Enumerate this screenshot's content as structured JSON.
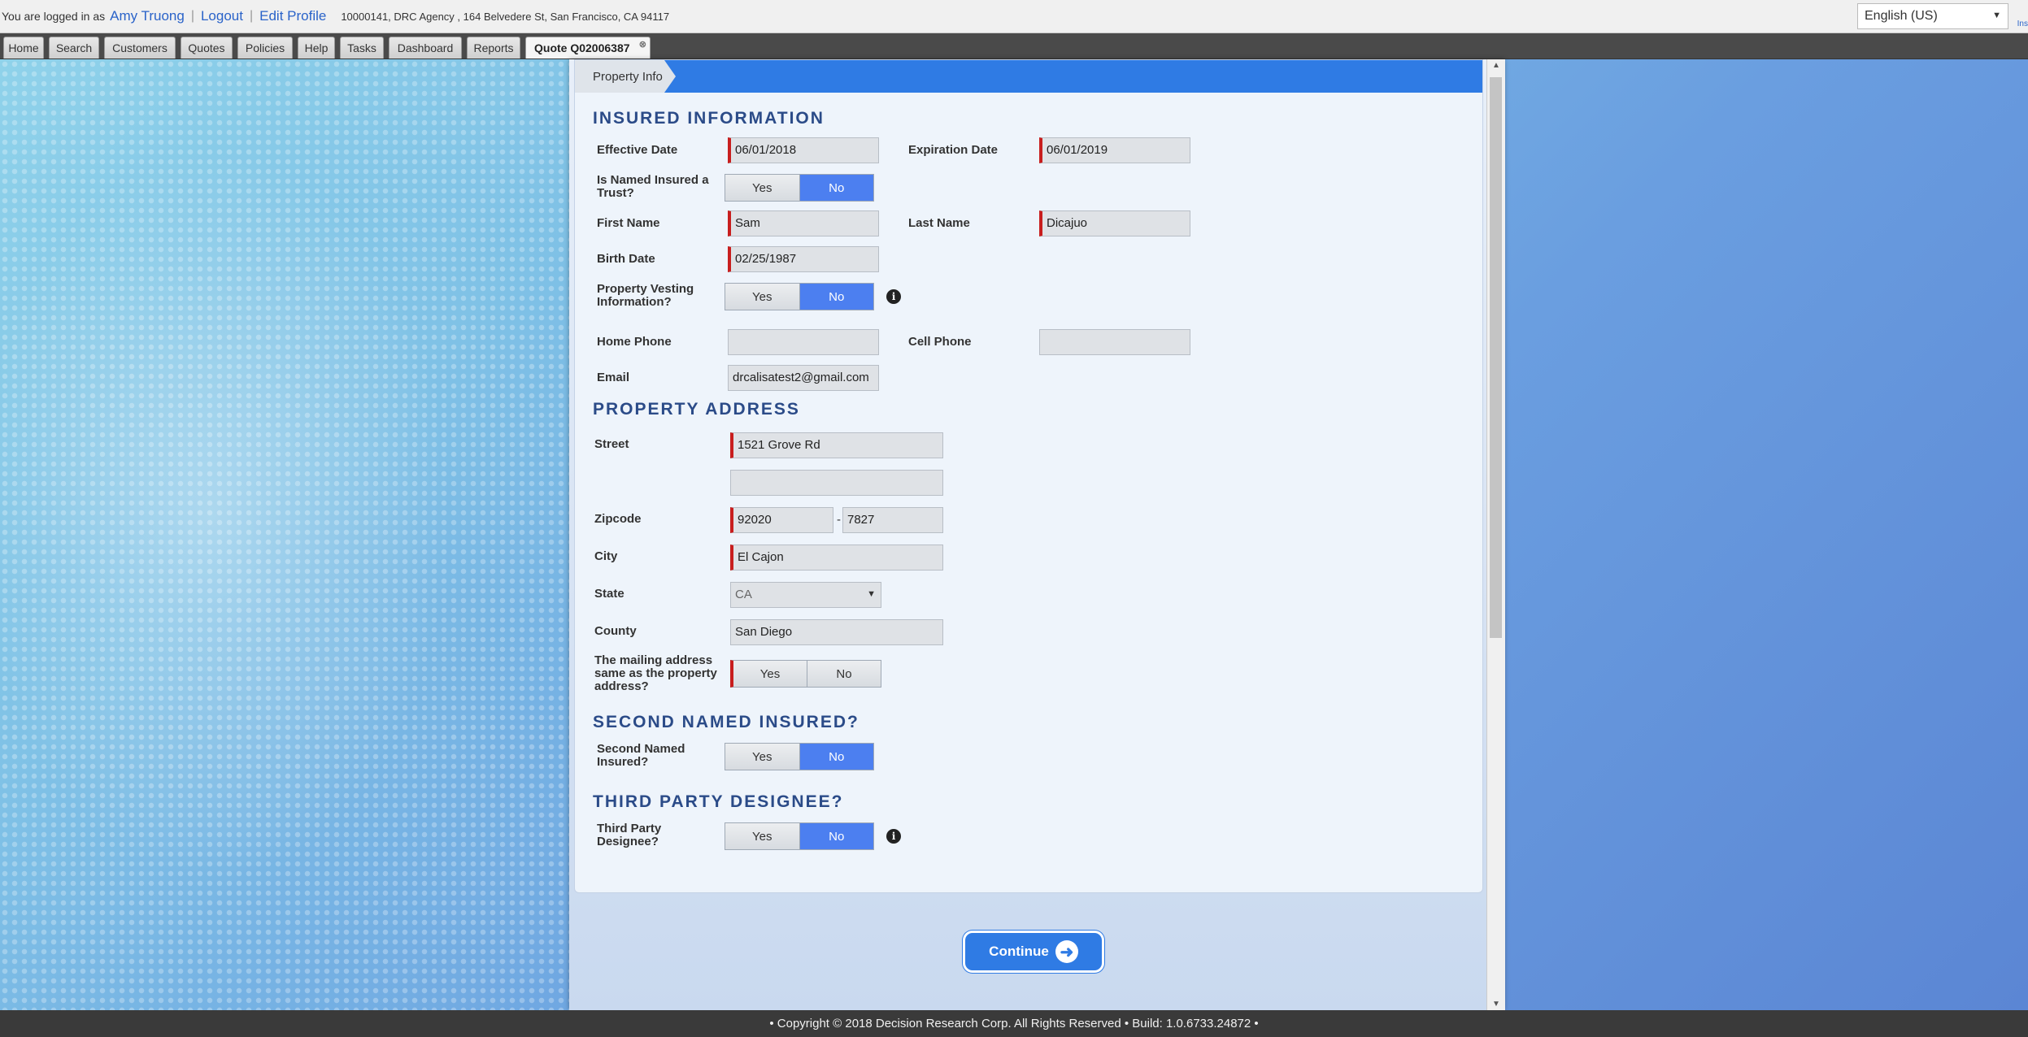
{
  "topbar": {
    "logged_in_as": "You are logged in as",
    "user": "Amy Truong",
    "logout": "Logout",
    "edit_profile": "Edit Profile",
    "agency": "10000141, DRC Agency , 164 Belvedere St, San Francisco, CA 94117",
    "language": "English (US)",
    "edge_text": "Ins"
  },
  "nav": {
    "tabs": [
      "Home",
      "Search",
      "Customers",
      "Quotes",
      "Policies",
      "Help",
      "Tasks",
      "Dashboard",
      "Reports"
    ],
    "active_tab": "Quote Q02006387"
  },
  "form": {
    "breadcrumb": "Property Info",
    "sections": {
      "insured": "INSURED INFORMATION",
      "property": "PROPERTY ADDRESS",
      "second": "SECOND NAMED INSURED?",
      "third": "THIRD PARTY DESIGNEE?"
    },
    "labels": {
      "effective_date": "Effective Date",
      "expiration_date": "Expiration Date",
      "trust": "Is Named Insured a Trust?",
      "first_name": "First Name",
      "last_name": "Last Name",
      "birth_date": "Birth Date",
      "vesting": "Property Vesting Information?",
      "home_phone": "Home Phone",
      "cell_phone": "Cell Phone",
      "email": "Email",
      "street": "Street",
      "zipcode": "Zipcode",
      "city": "City",
      "state": "State",
      "county": "County",
      "mailing": "The mailing address same as the property address?",
      "second_named": "Second Named Insured?",
      "third_party": "Third Party Designee?"
    },
    "values": {
      "effective_date": "06/01/2018",
      "expiration_date": "06/01/2019",
      "first_name": "Sam",
      "last_name": "Dicajuo",
      "birth_date": "02/25/1987",
      "home_phone": "",
      "cell_phone": "",
      "email": "drcalisatest2@gmail.com",
      "street": "1521 Grove Rd",
      "street2": "",
      "zip": "92020",
      "zip_ext": "7827",
      "city": "El Cajon",
      "state": "CA",
      "county": "San Diego"
    },
    "toggle": {
      "yes": "Yes",
      "no": "No"
    },
    "zip_dash": "-",
    "info_icon": "i",
    "continue": "Continue"
  },
  "footer": "• Copyright © 2018 Decision Research Corp. All Rights Reserved • Build: 1.0.6733.24872 •",
  "colors": {
    "accent": "#2f7be4",
    "toggle_on": "#4c7ff0",
    "required": "#c81e1e",
    "section": "#2b4b88"
  }
}
